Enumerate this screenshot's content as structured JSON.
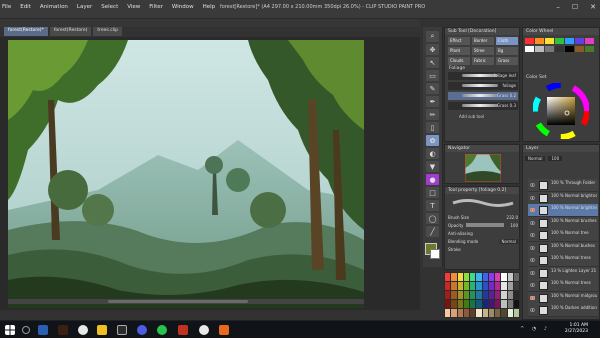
{
  "menu": [
    "File",
    "Edit",
    "Animation",
    "Layer",
    "Select",
    "View",
    "Filter",
    "Window",
    "Help"
  ],
  "window_title": "forest[Restore]* (A4 297.00 x 210.00mm 350dpi 26.0%) - CLIP STUDIO PAINT PRO",
  "window_controls": {
    "minimize": "–",
    "maximize": "☐",
    "close": "✕"
  },
  "tabs": [
    {
      "label": "forest(Restore)*",
      "active": true
    },
    {
      "label": "forest(Restore)",
      "active": false
    },
    {
      "label": "trees.clip",
      "active": false
    }
  ],
  "subtool_panel": {
    "title": "Sub Tool [Decoration]",
    "groups": [
      "Effect",
      "Border",
      "Cloth",
      "Plant",
      "Stree",
      "Bg",
      "Clouds",
      "Fabric",
      "Grass"
    ],
    "selected_group": "Cloth",
    "section": "Foliage",
    "brushes": [
      {
        "name": "foliage leaf",
        "num": ""
      },
      {
        "name": "foliage",
        "num": ""
      },
      {
        "name": "Grass 0.2",
        "num": ""
      },
      {
        "name": "Grass 0.3",
        "num": ""
      }
    ],
    "add_label": "Add sub tool"
  },
  "navigator_title": "Navigator",
  "tool_property": {
    "title": "Tool property [foliage 0.2]",
    "rows": [
      {
        "label": "Brush Size",
        "value": "232.0"
      },
      {
        "label": "Opacity",
        "value": "100"
      },
      {
        "label": "Anti-aliasing",
        "value": ""
      },
      {
        "label": "Blending mode",
        "value": "Normal"
      },
      {
        "label": "Stroke",
        "value": ""
      }
    ]
  },
  "color_wheel_title": "Color Wheel",
  "color_set_title": "Color Set",
  "layer_panel": {
    "title": "Layer",
    "blend_mode": "Normal",
    "opacity": "100",
    "layers": [
      {
        "name": "100 % Through Folder 1",
        "selected": false,
        "marked": false
      },
      {
        "name": "100 % Normal brightness",
        "selected": false,
        "marked": false
      },
      {
        "name": "100 % Normal brightness 2",
        "selected": true,
        "marked": true
      },
      {
        "name": "100 % Normal brushes",
        "selected": false,
        "marked": false
      },
      {
        "name": "100 % Normal tree",
        "selected": false,
        "marked": false
      },
      {
        "name": "100 % Normal bushes",
        "selected": false,
        "marked": false
      },
      {
        "name": "100 % Normal trees",
        "selected": false,
        "marked": false
      },
      {
        "name": "13 % Lighten Layer 21",
        "selected": false,
        "marked": false
      },
      {
        "name": "100 % Normal trees",
        "selected": false,
        "marked": false
      },
      {
        "name": "100 % Normal midground 2",
        "selected": false,
        "marked": true
      },
      {
        "name": "100 % Darken additional bushes",
        "selected": false,
        "marked": false
      }
    ]
  },
  "taskbar": {
    "time": "1:01 AM",
    "date": "2/27/2023"
  }
}
